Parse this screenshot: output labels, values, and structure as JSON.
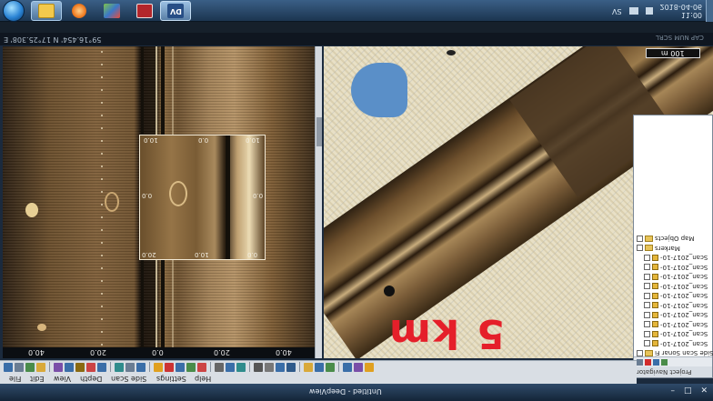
{
  "taskbar": {
    "apps": [
      {
        "name": "start",
        "color": "#2a83d4"
      },
      {
        "name": "windows-explorer",
        "color": "#f2c94c"
      },
      {
        "name": "media-player",
        "color": "#f07c22"
      },
      {
        "name": "paint",
        "color": "#7fc34a"
      },
      {
        "name": "app-w",
        "color": "#b3262b"
      },
      {
        "name": "deepview",
        "color": "#274e86",
        "label": "DV"
      }
    ],
    "tray": {
      "language": "SV",
      "time": "11:00",
      "date": "2018-04-06"
    }
  },
  "status": {
    "coordinates": "59°16.454' N 17°25.308' E",
    "indicators": "CAP NUM SCRL"
  },
  "sonar_view": {
    "scale_ticks": [
      "40.0",
      "20.0",
      "0.0",
      "20.0",
      "40.0"
    ],
    "zoom_box": {
      "top_ticks": [
        "10.0",
        "0.0",
        "10.0"
      ],
      "bottom_ticks": [
        "20.0",
        "10.0",
        "0.0"
      ],
      "side_left": "0.0",
      "side_right": "0.0"
    }
  },
  "map_view": {
    "range_label": "100 m",
    "overlay_text": "5 km",
    "label_color": "#e51f2a"
  },
  "navigator": {
    "title": "Project Navigator",
    "tree": [
      {
        "type": "group",
        "label": "Map Objects",
        "indent": 0
      },
      {
        "type": "group",
        "label": "Markers",
        "indent": 0
      },
      {
        "type": "scan",
        "label": "Scan_2017-10-",
        "indent": 1
      },
      {
        "type": "scan",
        "label": "Scan_2017-10-",
        "indent": 1
      },
      {
        "type": "scan",
        "label": "Scan_2017-10-",
        "indent": 1
      },
      {
        "type": "scan",
        "label": "Scan_2017-10-",
        "indent": 1
      },
      {
        "type": "scan",
        "label": "Scan_2017-10-",
        "indent": 1
      },
      {
        "type": "scan",
        "label": "Scan_2017-10-",
        "indent": 1
      },
      {
        "type": "scan",
        "label": "Scan_2017-10-",
        "indent": 1
      },
      {
        "type": "scan",
        "label": "Scan_2017-10-",
        "indent": 1
      },
      {
        "type": "scan",
        "label": "Scan_2017-10-",
        "indent": 1
      },
      {
        "type": "scan",
        "label": "Scan_2017-10-",
        "indent": 1
      },
      {
        "type": "group",
        "label": "Side Scan Sonar Fi",
        "indent": 0
      }
    ]
  },
  "menu": [
    "File",
    "Edit",
    "View",
    "Depth",
    "Side Scan",
    "Settings",
    "Help"
  ],
  "window": {
    "title": "Untitled - DeepView",
    "controls": [
      "–",
      "□",
      "✕"
    ]
  }
}
